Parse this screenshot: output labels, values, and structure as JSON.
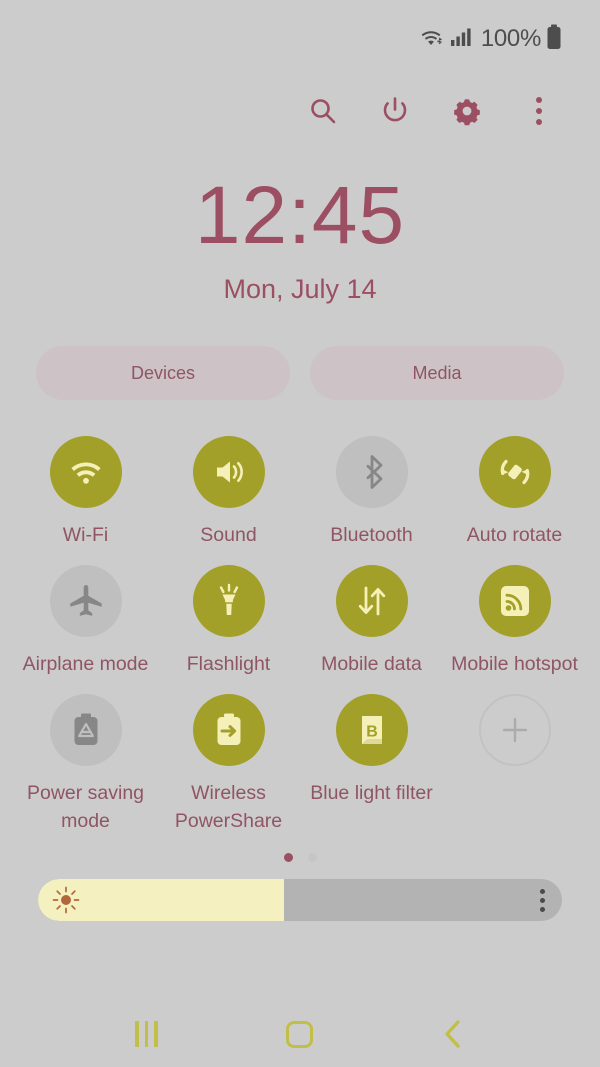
{
  "status_bar": {
    "wifi_icon": "wifi-data-icon",
    "signal_icon": "cellular-signal-icon",
    "battery_percent": "100%",
    "battery_icon": "battery-full-icon"
  },
  "toolbar": {
    "search_label": "search-icon",
    "power_label": "power-icon",
    "settings_label": "gear-icon",
    "more_label": "more-options-icon"
  },
  "clock": {
    "time": "12:45",
    "date": "Mon, July 14"
  },
  "pills": [
    {
      "label": "Devices"
    },
    {
      "label": "Media"
    }
  ],
  "tiles": [
    {
      "label": "Wi-Fi",
      "icon": "wifi-icon",
      "state": "on"
    },
    {
      "label": "Sound",
      "icon": "sound-icon",
      "state": "on"
    },
    {
      "label": "Bluetooth",
      "icon": "bluetooth-icon",
      "state": "off"
    },
    {
      "label": "Auto rotate",
      "icon": "auto-rotate-icon",
      "state": "on"
    },
    {
      "label": "Airplane mode",
      "icon": "airplane-icon",
      "state": "off"
    },
    {
      "label": "Flashlight",
      "icon": "flashlight-icon",
      "state": "on"
    },
    {
      "label": "Mobile data",
      "icon": "mobile-data-icon",
      "state": "on"
    },
    {
      "label": "Mobile hotspot",
      "icon": "mobile-hotspot-icon",
      "state": "on"
    },
    {
      "label": "Power saving mode",
      "icon": "power-saving-icon",
      "state": "off"
    },
    {
      "label": "Wireless PowerShare",
      "icon": "wireless-powershare-icon",
      "state": "on"
    },
    {
      "label": "Blue light filter",
      "icon": "blue-light-filter-icon",
      "state": "on"
    },
    {
      "label": "",
      "icon": "add-tile-icon",
      "state": "add"
    }
  ],
  "pagination": {
    "total": 2,
    "active_index": 0
  },
  "brightness": {
    "value_percent": 47,
    "sun_icon": "brightness-sun-icon",
    "menu_icon": "brightness-options-icon"
  },
  "navbar": {
    "recents_label": "recents-icon",
    "home_label": "home-icon",
    "back_label": "back-icon"
  },
  "colors": {
    "background": "#cccccc",
    "accent_crimson": "#9c4f63",
    "label_crimson": "#8f5565",
    "tile_on": "#a3a02a",
    "tile_off": "#bfbfbf",
    "icon_on": "#f5f0b8",
    "icon_off": "#878787",
    "pill_bg": "#cdc3c6",
    "brightness_fill": "#f5f0c0",
    "nav_olive": "#c2bf48"
  }
}
